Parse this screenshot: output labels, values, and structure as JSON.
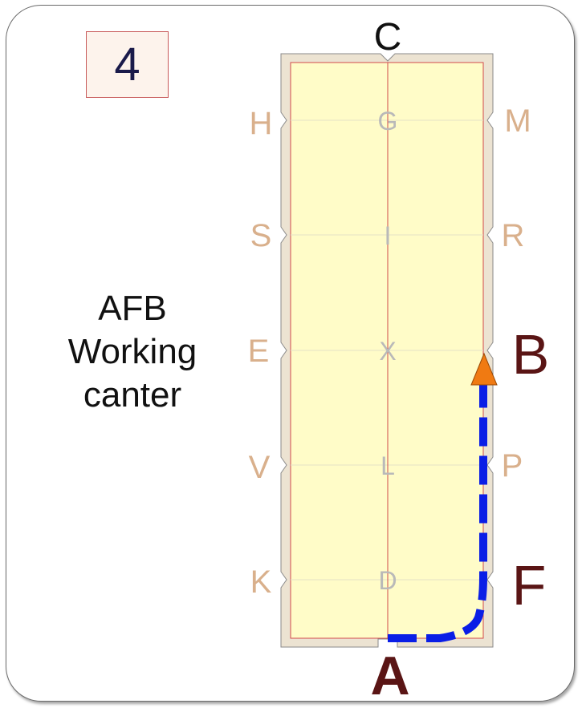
{
  "page_number": "4",
  "caption": {
    "line1": "AFB",
    "line2": "Working",
    "line3": "canter"
  },
  "letters": {
    "C": "C",
    "A": "A",
    "B": "B",
    "F": "F",
    "H": "H",
    "S": "S",
    "E": "E",
    "V": "V",
    "K": "K",
    "M": "M",
    "R": "R",
    "P": "P",
    "G": "G",
    "I": "I",
    "X": "X",
    "L": "L",
    "D": "D"
  },
  "colors": {
    "arena_fill": "#fffcc8",
    "arena_border": "#ece3d2",
    "center_line": "#d24a4a",
    "outer_letters": "#d9b08c",
    "inner_letters": "#b9b9b9",
    "highlight_letters": "#5a1515",
    "path": "#0a1ee6",
    "arrow": "#f07a12"
  }
}
